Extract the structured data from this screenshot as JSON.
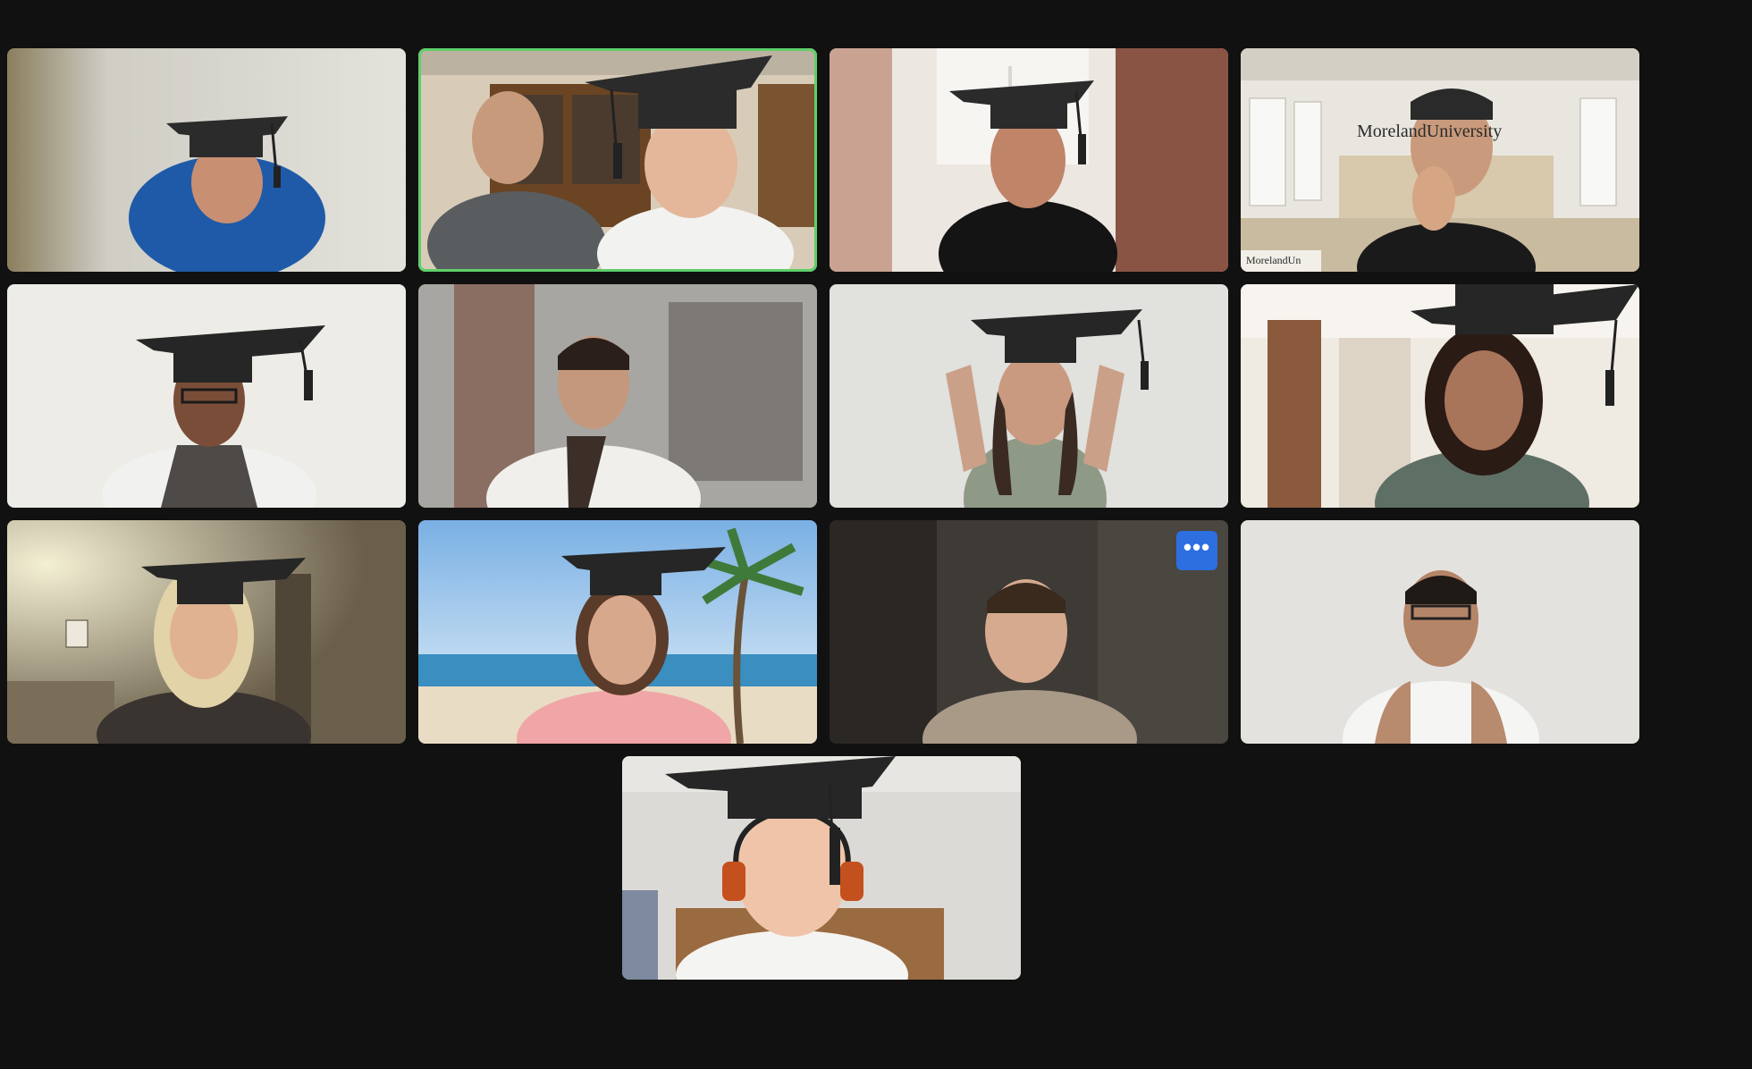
{
  "meeting": {
    "view": "gallery",
    "participant_count": 13,
    "active_speaker_index": 1,
    "more_options_label": "•••"
  },
  "participants": [
    {
      "scene": "plain-wall",
      "cap": true
    },
    {
      "scene": "kitchen-pair",
      "cap": true
    },
    {
      "scene": "curtain-window",
      "cap": true
    },
    {
      "scene": "virtual-hall",
      "cap": false,
      "background_text": "MorelandUniversity",
      "footer_text": "MorelandUn"
    },
    {
      "scene": "white-wall",
      "cap": true
    },
    {
      "scene": "blurred-room",
      "cap": false
    },
    {
      "scene": "white-wall",
      "cap": true
    },
    {
      "scene": "doorway",
      "cap": true
    },
    {
      "scene": "dim-room",
      "cap": true
    },
    {
      "scene": "beach",
      "cap": true
    },
    {
      "scene": "blurred-dark",
      "cap": false
    },
    {
      "scene": "plain-wall",
      "cap": false
    },
    {
      "scene": "bedroom",
      "cap": true
    }
  ],
  "colors": {
    "background": "#111111",
    "active_border": "#5fcf6a",
    "more_button": "#2d6ee0"
  }
}
